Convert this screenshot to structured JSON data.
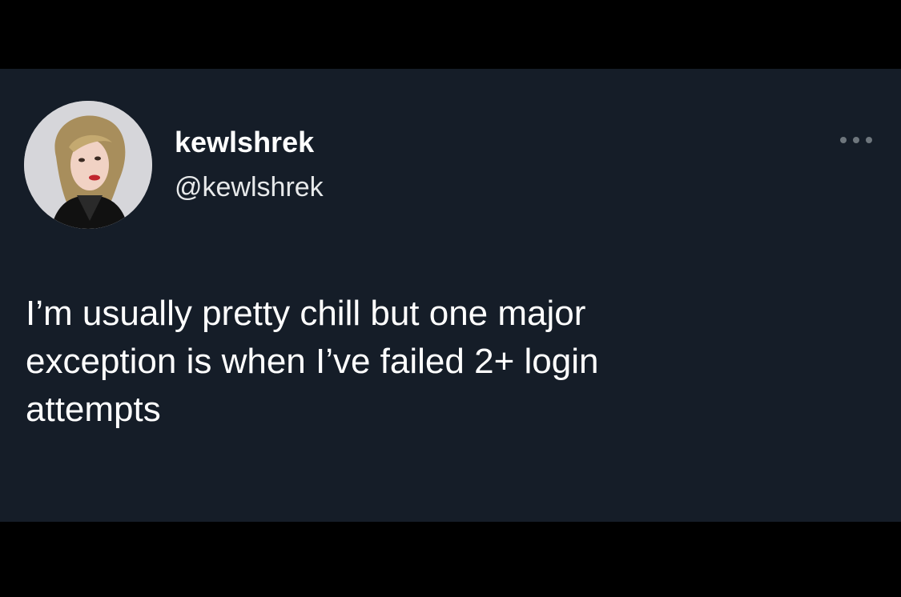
{
  "tweet": {
    "author": {
      "display_name": "kewlshrek",
      "handle": "@kewlshrek",
      "avatar_icon": "profile-photo-icon"
    },
    "more_icon": "more-horizontal-icon",
    "text": "I’m usually pretty chill but one major\nexception is when I’ve failed 2+ login\nattempts"
  },
  "colors": {
    "page_background": "#000000",
    "card_background": "#151d28",
    "text_primary": "#ffffff",
    "icon_muted": "#6e767d"
  }
}
